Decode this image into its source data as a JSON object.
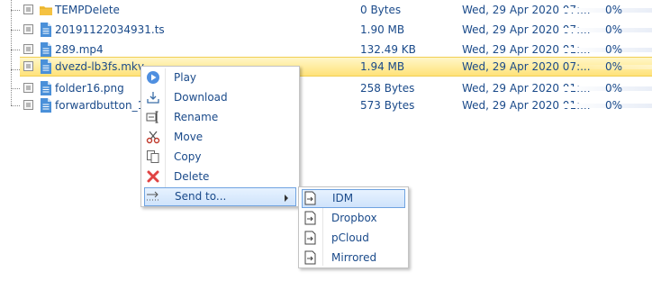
{
  "files": [
    {
      "name": "TEMPDelete",
      "size": "0 Bytes",
      "date": "Wed, 29 Apr 2020 07:...",
      "progress": "0%",
      "icon": "folder-icon"
    },
    {
      "name": "20191122034931.ts",
      "size": "1.90 MB",
      "date": "Wed, 29 Apr 2020 07:...",
      "progress": "0%",
      "icon": "file-icon"
    },
    {
      "name": "289.mp4",
      "size": "132.49 KB",
      "date": "Wed, 29 Apr 2020 01:...",
      "progress": "0%",
      "icon": "file-icon"
    },
    {
      "name": "dvezd-lb3fs.mkv",
      "size": "1.94 MB",
      "date": "Wed, 29 Apr 2020 07:...",
      "progress": "0%",
      "icon": "file-icon",
      "selected": true
    },
    {
      "name": "folder16.png",
      "size": "258 Bytes",
      "date": "Wed, 29 Apr 2020 01:...",
      "progress": "0%",
      "icon": "file-icon"
    },
    {
      "name": "forwardbutton_1...",
      "size": "573 Bytes",
      "date": "Wed, 29 Apr 2020 01:...",
      "progress": "0%",
      "icon": "file-icon"
    }
  ],
  "context_menu": {
    "items": [
      {
        "label": "Play",
        "icon": "play-icon"
      },
      {
        "label": "Download",
        "icon": "download-icon"
      },
      {
        "label": "Rename",
        "icon": "rename-icon"
      },
      {
        "label": "Move",
        "icon": "scissors-icon"
      },
      {
        "label": "Copy",
        "icon": "copy-icon"
      },
      {
        "label": "Delete",
        "icon": "delete-icon"
      },
      {
        "label": "Send to...",
        "icon": "send-to-icon",
        "has_submenu": true,
        "highlighted": true
      }
    ]
  },
  "submenu": {
    "items": [
      {
        "label": "IDM",
        "icon": "send-icon",
        "highlighted": true
      },
      {
        "label": "Dropbox",
        "icon": "send-icon"
      },
      {
        "label": "pCloud",
        "icon": "send-icon"
      },
      {
        "label": "Mirrored",
        "icon": "send-icon"
      }
    ]
  },
  "colors": {
    "text": "#1a4a8a",
    "selection": "#ffe279",
    "folder": "#f5c242",
    "file": "#4a90d9",
    "highlight_border": "#6fa3e0"
  }
}
